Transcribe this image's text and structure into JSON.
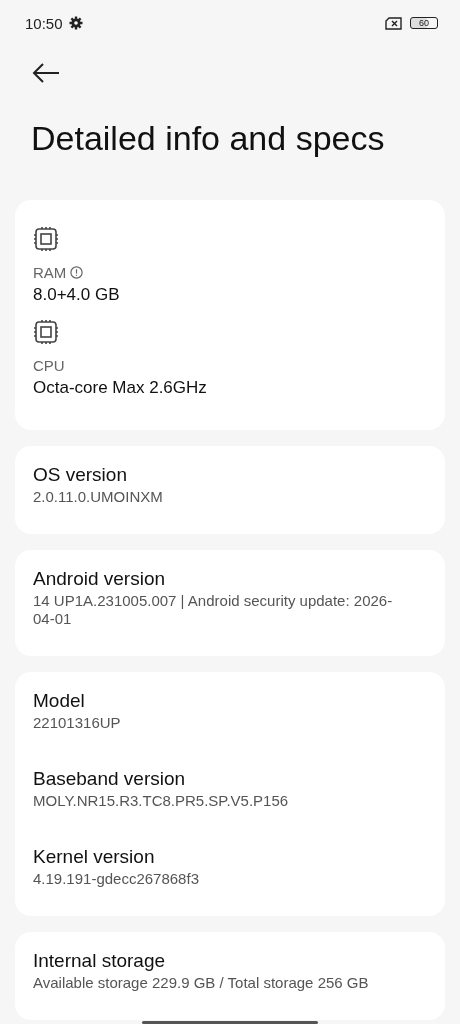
{
  "status_bar": {
    "time": "10:50",
    "battery": "60"
  },
  "title": "Detailed info and specs",
  "cards": [
    {
      "kind": "hardware",
      "items": [
        {
          "label": "RAM",
          "info_icon": true,
          "value": "8.0+4.0 GB"
        },
        {
          "label": "CPU",
          "info_icon": false,
          "value": "Octa-core Max 2.6GHz"
        }
      ]
    },
    {
      "kind": "plain",
      "items": [
        {
          "label": "OS version",
          "value": "2.0.11.0.UMOINXM"
        }
      ]
    },
    {
      "kind": "plain",
      "items": [
        {
          "label": "Android version",
          "value": "14 UP1A.231005.007 | Android security update: 2026-04-01"
        }
      ]
    },
    {
      "kind": "plain",
      "items": [
        {
          "label": "Model",
          "value": "22101316UP"
        },
        {
          "label": "Baseband version",
          "value": "MOLY.NR15.R3.TC8.PR5.SP.V5.P156"
        },
        {
          "label": "Kernel version",
          "value": "4.19.191-gdecc267868f3"
        }
      ]
    },
    {
      "kind": "plain",
      "items": [
        {
          "label": "Internal storage",
          "value": "Available storage  229.9 GB / Total storage  256 GB"
        }
      ]
    }
  ]
}
